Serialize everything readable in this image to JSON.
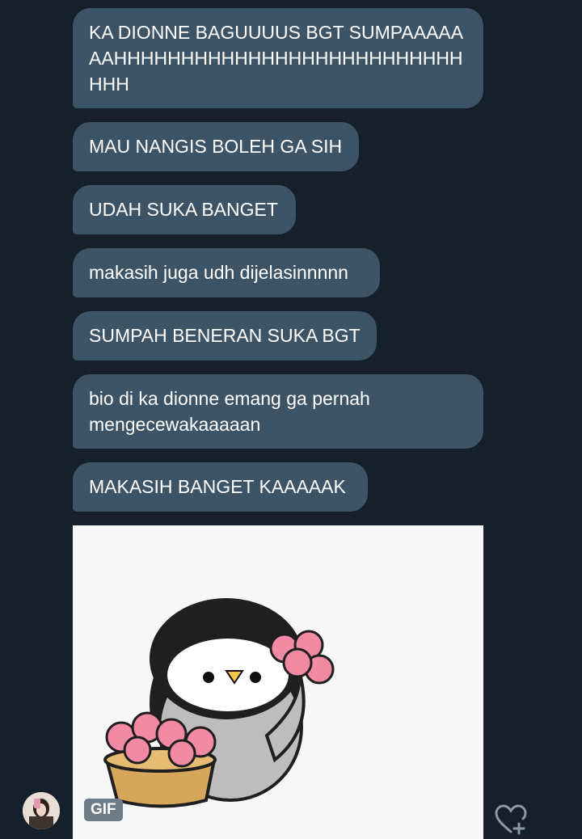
{
  "messages": [
    {
      "text": "KA DIONNE BAGUUUUS BGT SUMPAAAAAAAHHHHHHHHHHHHHHHHHHHHHHHHHHHHH"
    },
    {
      "text": "MAU NANGIS BOLEH GA SIH"
    },
    {
      "text": "UDAH SUKA BANGET"
    },
    {
      "text": "makasih juga udh dijelasinnnnn"
    },
    {
      "text": "SUMPAH BENERAN SUKA BGT"
    },
    {
      "text": "bio di ka dionne emang ga pernah mengecewakaaaaan"
    },
    {
      "text": "MAKASIH BANGET KAAAAAK"
    }
  ],
  "gif": {
    "badge": "GIF",
    "subject": "penguin holding hearts"
  },
  "icons": {
    "like": "heart-plus-icon",
    "avatar": "avatar"
  },
  "colors": {
    "background": "#15202b",
    "bubble": "#3d5466",
    "text": "#ffffff"
  }
}
